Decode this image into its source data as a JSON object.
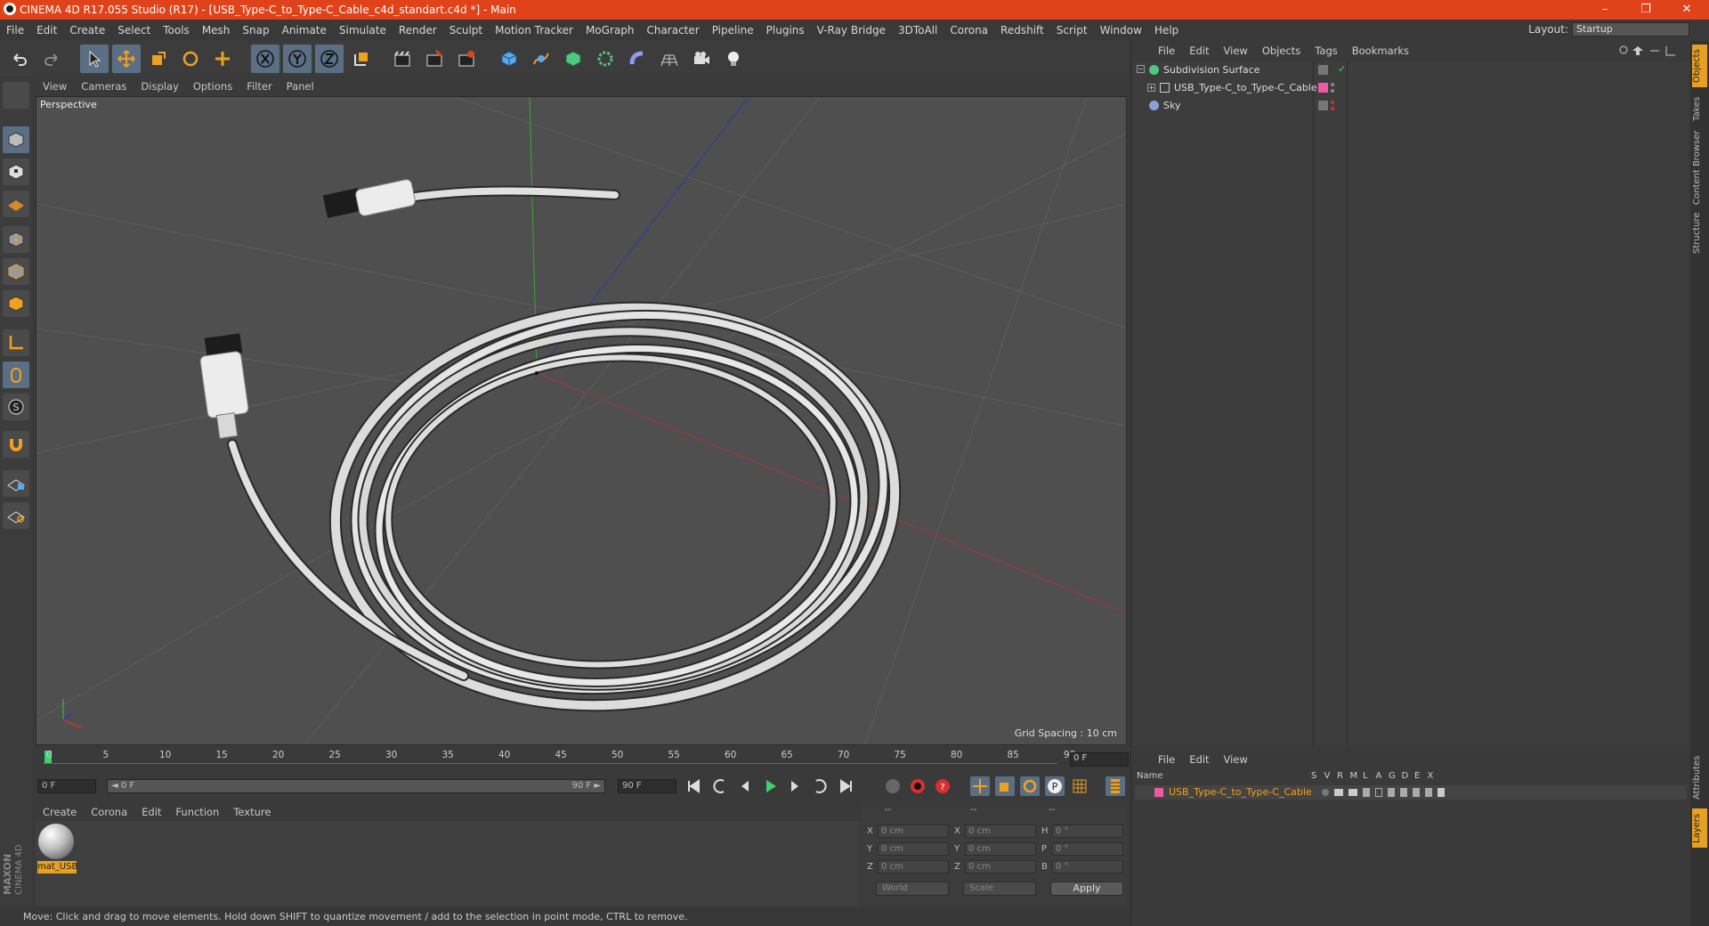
{
  "window": {
    "title": "CINEMA 4D R17.055 Studio (R17) - [USB_Type-C_to_Type-C_Cable_c4d_standart.c4d *] - Main",
    "min": "–",
    "restore": "❐",
    "close": "✕"
  },
  "menubar": [
    "File",
    "Edit",
    "Create",
    "Select",
    "Tools",
    "Mesh",
    "Snap",
    "Animate",
    "Simulate",
    "Render",
    "Sculpt",
    "Motion Tracker",
    "MoGraph",
    "Character",
    "Pipeline",
    "Plugins",
    "V-Ray Bridge",
    "3DToAll",
    "Corona",
    "Redshift",
    "Script",
    "Window",
    "Help"
  ],
  "layout": {
    "label": "Layout:",
    "value": "Startup"
  },
  "viewport": {
    "menu": [
      "View",
      "Cameras",
      "Display",
      "Options",
      "Filter",
      "Panel"
    ],
    "label": "Perspective",
    "grid_spacing": "Grid Spacing : 10 cm"
  },
  "timeline": {
    "ticks": [
      "0",
      "5",
      "10",
      "15",
      "20",
      "25",
      "30",
      "35",
      "40",
      "45",
      "50",
      "55",
      "60",
      "65",
      "70",
      "75",
      "80",
      "85",
      "90"
    ],
    "current_frame": "0 F",
    "start": "0 F",
    "range_start": "◄ 0 F",
    "range_end": "90 F ►",
    "end": "90 F"
  },
  "materials": {
    "menu": [
      "Create",
      "Corona",
      "Edit",
      "Function",
      "Texture"
    ],
    "items": [
      {
        "label": "mat_USB"
      }
    ]
  },
  "coords": {
    "headers": [
      "--",
      "--",
      "--"
    ],
    "rows": [
      {
        "l1": "X",
        "v1": "0 cm",
        "l2": "X",
        "v2": "0 cm",
        "l3": "H",
        "v3": "0 °"
      },
      {
        "l1": "Y",
        "v1": "0 cm",
        "l2": "Y",
        "v2": "0 cm",
        "l3": "P",
        "v3": "0 °"
      },
      {
        "l1": "Z",
        "v1": "0 cm",
        "l2": "Z",
        "v2": "0 cm",
        "l3": "B",
        "v3": "0 °"
      }
    ],
    "mode": "World",
    "transform": "Scale",
    "apply": "Apply"
  },
  "status": "Move: Click and drag to move elements. Hold down SHIFT to quantize movement / add to the selection in point mode, CTRL to remove.",
  "object_manager": {
    "menu": [
      "File",
      "Edit",
      "View",
      "Objects",
      "Tags",
      "Bookmarks"
    ],
    "objects": [
      {
        "name": "Subdivision Surface"
      },
      {
        "name": "USB_Type-C_to_Type-C_Cable"
      },
      {
        "name": "Sky"
      }
    ]
  },
  "layer_manager": {
    "menu": [
      "File",
      "Edit",
      "View"
    ],
    "header": {
      "name": "Name",
      "cols": [
        "S",
        "V",
        "R",
        "M",
        "L",
        "A",
        "G",
        "D",
        "E",
        "X"
      ]
    },
    "layers": [
      {
        "name": "USB_Type-C_to_Type-C_Cable",
        "color": "#ee5aa0"
      }
    ]
  },
  "right_tabs": [
    "Objects",
    "Takes",
    "Content Browser",
    "Structure",
    "Attributes",
    "Layers"
  ],
  "brand": {
    "line1": "MAXON",
    "line2": "CINEMA 4D"
  },
  "colors": {
    "titlebar": "#e0421a",
    "selection": "#e8a020",
    "accent_blue": "#5a6f84"
  }
}
